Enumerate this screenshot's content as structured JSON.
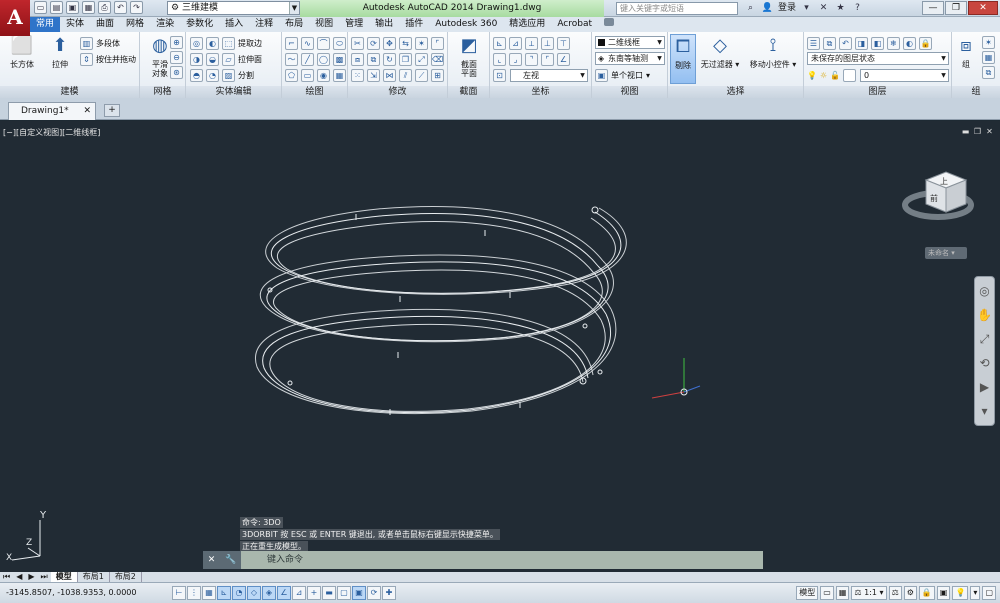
{
  "app": {
    "title": "Autodesk AutoCAD 2014    Drawing1.dwg",
    "logo": "A",
    "workspace": "三维建模",
    "search_placeholder": "键入关键字或短语",
    "login": "登录"
  },
  "menu_tabs": [
    "常用",
    "实体",
    "曲面",
    "网格",
    "渲染",
    "参数化",
    "插入",
    "注释",
    "布局",
    "视图",
    "管理",
    "输出",
    "插件",
    "Autodesk 360",
    "精选应用",
    "Acrobat"
  ],
  "ribbon": {
    "modeling": {
      "title": "建模",
      "box": "长方体",
      "extrude": "拉伸",
      "polysolid": "多段体",
      "presspull": "按住并拖动"
    },
    "mesh": {
      "title": "网格",
      "smooth": "平滑\n对象"
    },
    "solid_edit": {
      "title": "实体编辑",
      "extract_edges": "提取边",
      "extrude_faces": "拉伸面",
      "separate": "分割"
    },
    "draw": {
      "title": "绘图"
    },
    "modify": {
      "title": "修改"
    },
    "section": {
      "title": "截面",
      "plane": "截面\n平面"
    },
    "coordinates": {
      "title": "坐标",
      "left": "左视"
    },
    "view": {
      "title": "视图",
      "visual_style": "二维线框",
      "view_dir": "东南等轴测",
      "viewport": "单个视口"
    },
    "selection": {
      "title": "选择",
      "culling": "剔除",
      "no_filter": "无过滤器",
      "gizmo": "移动小控件"
    },
    "layers": {
      "title": "图层",
      "state": "未保存的图层状态",
      "current_layer": "0"
    },
    "groups": {
      "title": "组",
      "group": "组"
    }
  },
  "document": {
    "tab": "Drawing1*"
  },
  "viewport": {
    "label": "[−][自定义视图][二维线框]",
    "viewcube_top": "上",
    "viewcube_front": "前",
    "viewcube_menu": "未命名",
    "ucs_x": "X",
    "ucs_y": "Y",
    "ucs_z": "Z"
  },
  "command": {
    "history": [
      "命令: 3DO",
      "3DORBIT 按 ESC 或 ENTER 键退出, 或者单击鼠标右键显示快捷菜单。",
      "正在重生成模型。"
    ],
    "placeholder": "键入命令"
  },
  "layout_tabs": [
    "模型",
    "布局1",
    "布局2"
  ],
  "status": {
    "coords": "-3145.8507, -1038.9353, 0.0000",
    "model": "模型",
    "scale": "1:1"
  },
  "colors": {
    "accent": "#2f74c9",
    "viewport_bg": "#212b34",
    "helix": "#e8ecef",
    "logo": "#c0262c"
  }
}
